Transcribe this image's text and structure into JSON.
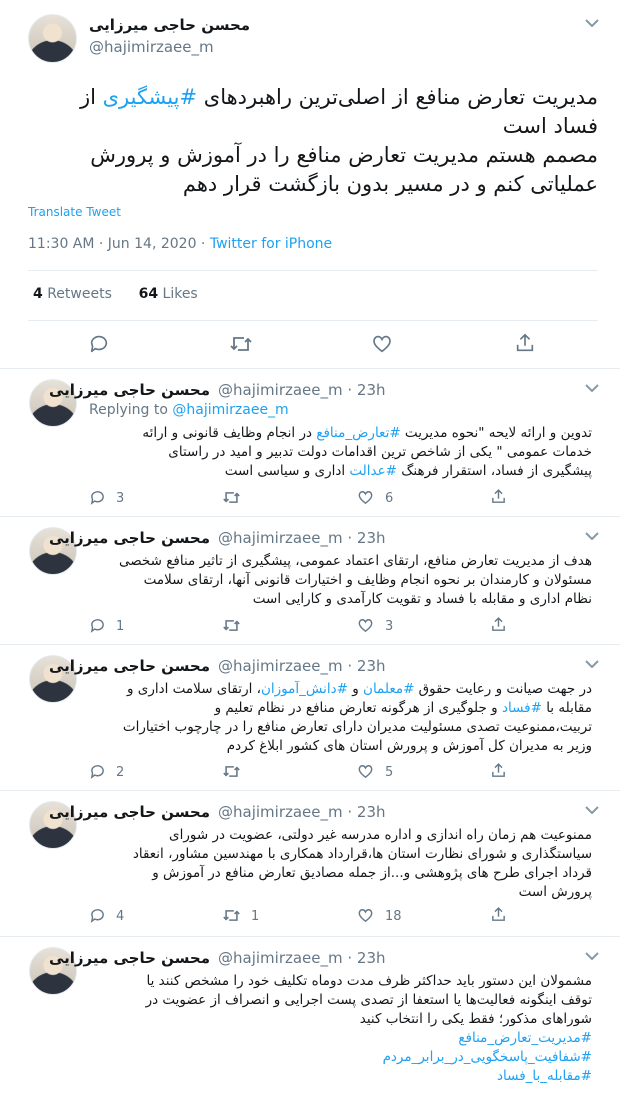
{
  "main": {
    "name": "محسن حاجی میرزایی",
    "handle": "@hajimirzaee_m",
    "text_l1_pre": "مدیریت تعارض منافع از اصلی‌ترین راهبردهای ",
    "text_l1_tag": "#پیشگیری",
    "text_l1_post": " از",
    "text_l2": "فساد است",
    "text_l3": "مصمم هستم مدیریت تعارض منافع را در آموزش و پرورش",
    "text_l4": "عملیاتی کنم و در مسیر بدون بازگشت قرار دهم",
    "translate": "Translate Tweet",
    "time": "11:30 AM · Jun 14, 2020 · ",
    "source": "Twitter for iPhone",
    "retweets_count": "4",
    "retweets_label": "Retweets",
    "likes_count": "64",
    "likes_label": "Likes"
  },
  "replies": [
    {
      "name": "محسن حاجی میرزایی",
      "handle": "@hajimirzaee_m · 23h",
      "replying_prefix": "Replying to ",
      "replying_to": "@hajimirzaee_m",
      "l1_pre": "تدوین و ارائه لایحه \"نحوه مدیریت ",
      "l1_tag": "#تعارض_منافع",
      "l1_post": " در انجام وظایف قانونی و ارائه",
      "l2": "خدمات عمومی \" یکی از شاخص ترین اقدامات دولت تدبیر و امید در راستای",
      "l3_pre": "پیشگیری از فساد، استقرار فرهنگ ",
      "l3_tag": "#عدالت",
      "l3_post": " اداری و سیاسی است",
      "replies": "3",
      "retweets": "",
      "likes": "6"
    },
    {
      "name": "محسن حاجی میرزایی",
      "handle": "@hajimirzaee_m · 23h",
      "l1": "هدف از مدیریت تعارض منافع، ارتقای اعتماد عمومی، پیشگیری از تاثیر منافع شخصی",
      "l2": "مسئولان و کارمندان بر نحوه انجام وظایف و اختیارات قانونی آنها، ارتقای سلامت",
      "l3": "نظام اداری و مقابله با فساد و تقویت کارآمدی و کارایی است",
      "replies": "1",
      "retweets": "",
      "likes": "3"
    },
    {
      "name": "محسن حاجی میرزایی",
      "handle": "@hajimirzaee_m · 23h",
      "l1_pre": "در جهت صیانت و رعایت حقوق ",
      "l1_tag1": "#معلمان",
      "l1_mid": " و ",
      "l1_tag2": "#دانش_آموزان",
      "l1_post": "، ارتقای سلامت اداری و",
      "l2_pre": "مقابله با ",
      "l2_tag": "#فساد",
      "l2_post": " و جلوگیری از هرگونه تعارض منافع در نظام تعلیم و",
      "l3": "تربیت،ممنوعیت تصدی مسئولیت مدیران  دارای تعارض منافع را در چارچوب اختیارات",
      "l4": "وزیر به مدیران کل آموزش و پرورش  استان های کشور ابلاغ کردم",
      "replies": "2",
      "retweets": "",
      "likes": "5"
    },
    {
      "name": "محسن حاجی میرزایی",
      "handle": "@hajimirzaee_m · 23h",
      "l1": "ممنوعیت هم زمان راه اندازی و اداره مدرسه غیر دولتی، عضویت در شورای",
      "l2": "سیاستگذاری و شورای نظارت استان ها،قرارداد همکاری با مهندسین مشاور، انعقاد",
      "l3": "قرداد اجرای طرح های پژوهشی و...از جمله مصادیق تعارض منافع  در آموزش و",
      "l4": "پرورش  است",
      "replies": "4",
      "retweets": "1",
      "likes": "18"
    },
    {
      "name": "محسن حاجی میرزایی",
      "handle": "@hajimirzaee_m · 23h",
      "l1": "مشمولان این دستور باید حداکثر ظرف مدت دوماه تکلیف خود را مشخص کنند یا",
      "l2": "توقف اینگونه فعالیت‌ها یا استعفا از تصدی پست اجرایی و انصراف از عضویت در",
      "l3": "شوراهای مذکور؛ فقط یکی را انتخاب کنید",
      "tag1": "#مدیریت_تعارض_منافع",
      "tag2": "#شفافیت_پاسخگویی_در_برابر_مردم",
      "tag3": "#مقابله_با_فساد"
    }
  ],
  "icons": {
    "reply": "reply-icon",
    "retweet": "retweet-icon",
    "like": "heart-icon",
    "share": "share-icon",
    "more": "chevron-down-icon"
  },
  "colors": {
    "link": "#1da1f2",
    "muted": "#657786",
    "text": "#14171a",
    "border": "#e6ecf0"
  }
}
